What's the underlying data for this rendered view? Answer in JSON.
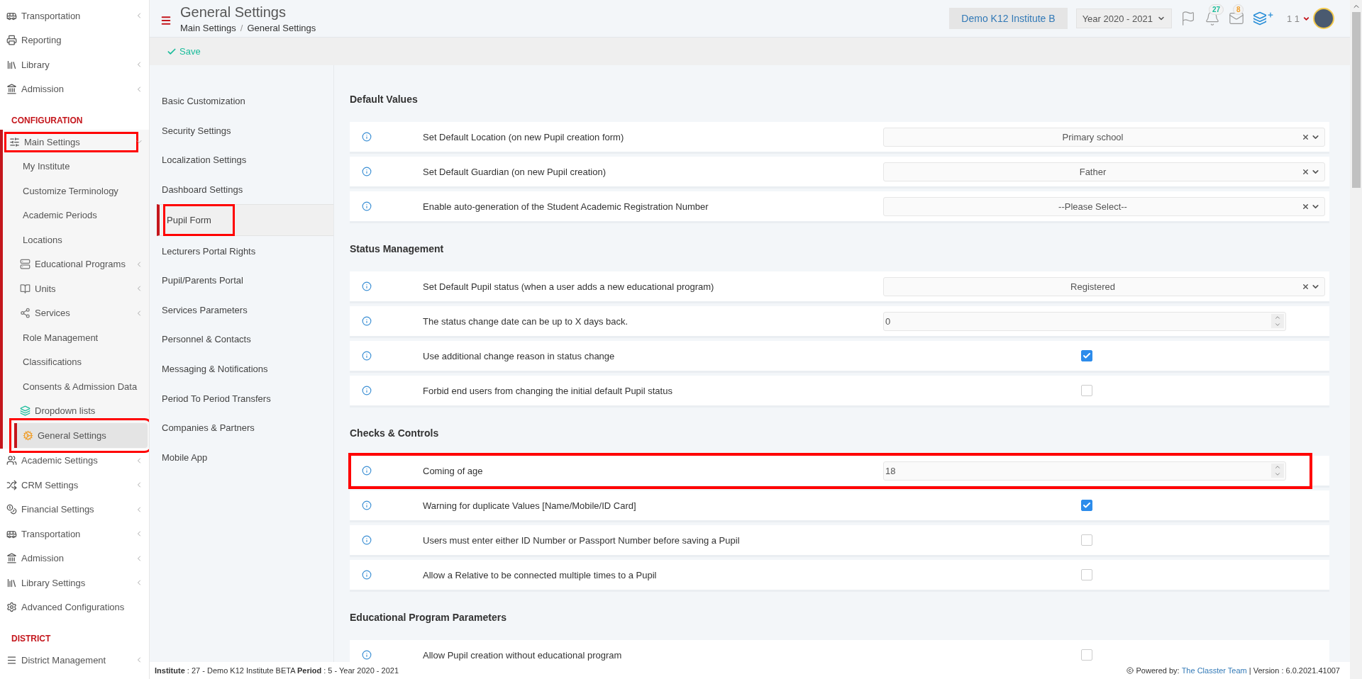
{
  "header": {
    "title": "General Settings",
    "breadcrumbs": [
      "Main Settings",
      "General Settings"
    ],
    "breadcrumb_separator": "/",
    "institute": "Demo K12 Institute B",
    "year": "Year 2020 - 2021",
    "notifications": "27",
    "messages": "8",
    "user": "1 1"
  },
  "toolbar": {
    "save": "Save"
  },
  "sidebar": {
    "sections": [
      {
        "items": [
          {
            "label": "Transportation",
            "has_submenu": true,
            "expanded": false,
            "selected": false,
            "highlighted": false
          },
          {
            "label": "Reporting",
            "has_submenu": false,
            "selected": false,
            "highlighted": false
          },
          {
            "label": "Library",
            "has_submenu": true,
            "expanded": false,
            "selected": false,
            "highlighted": false
          },
          {
            "label": "Admission",
            "has_submenu": true,
            "expanded": false,
            "selected": false,
            "highlighted": false
          }
        ]
      },
      {
        "title": "CONFIGURATION",
        "items": [
          {
            "label": "Main Settings",
            "has_submenu": true,
            "expanded": true,
            "selected": false,
            "highlighted": true,
            "children": [
              {
                "label": "My Institute",
                "has_submenu": false,
                "selected": false,
                "highlighted": false
              },
              {
                "label": "Customize Terminology",
                "has_submenu": false,
                "selected": false,
                "highlighted": false
              },
              {
                "label": "Academic Periods",
                "has_submenu": false,
                "selected": false,
                "highlighted": false
              },
              {
                "label": "Locations",
                "has_submenu": false,
                "selected": false,
                "highlighted": false
              },
              {
                "label": "Educational Programs",
                "has_submenu": true,
                "selected": false,
                "highlighted": false
              },
              {
                "label": "Units",
                "has_submenu": true,
                "selected": false,
                "highlighted": false
              },
              {
                "label": "Services",
                "has_submenu": true,
                "selected": false,
                "highlighted": false
              },
              {
                "label": "Role Management",
                "has_submenu": false,
                "selected": false,
                "highlighted": false
              },
              {
                "label": "Classifications",
                "has_submenu": false,
                "selected": false,
                "highlighted": false
              },
              {
                "label": "Consents & Admission Data",
                "has_submenu": false,
                "selected": false,
                "highlighted": false
              },
              {
                "label": "Dropdown lists",
                "has_submenu": false,
                "selected": false,
                "highlighted": false
              },
              {
                "label": "General Settings",
                "has_submenu": false,
                "selected": true,
                "highlighted": true
              }
            ]
          },
          {
            "label": "Academic Settings",
            "has_submenu": true,
            "expanded": false,
            "selected": false,
            "highlighted": false
          },
          {
            "label": "CRM Settings",
            "has_submenu": true,
            "expanded": false,
            "selected": false,
            "highlighted": false
          },
          {
            "label": "Financial Settings",
            "has_submenu": true,
            "expanded": false,
            "selected": false,
            "highlighted": false
          },
          {
            "label": "Transportation",
            "has_submenu": true,
            "expanded": false,
            "selected": false,
            "highlighted": false
          },
          {
            "label": "Admission",
            "has_submenu": true,
            "expanded": false,
            "selected": false,
            "highlighted": false
          },
          {
            "label": "Library Settings",
            "has_submenu": true,
            "expanded": false,
            "selected": false,
            "highlighted": false
          },
          {
            "label": "Advanced Configurations",
            "has_submenu": false,
            "selected": false,
            "highlighted": false
          }
        ]
      },
      {
        "title": "DISTRICT",
        "items": [
          {
            "label": "District Management",
            "has_submenu": true,
            "expanded": false,
            "selected": false,
            "highlighted": false
          }
        ]
      }
    ]
  },
  "submenu": [
    {
      "label": "Basic Customization",
      "selected": false,
      "highlighted": false
    },
    {
      "label": "Security Settings",
      "selected": false,
      "highlighted": false
    },
    {
      "label": "Localization Settings",
      "selected": false,
      "highlighted": false
    },
    {
      "label": "Dashboard Settings",
      "selected": false,
      "highlighted": false
    },
    {
      "label": "Pupil Form",
      "selected": true,
      "highlighted": true
    },
    {
      "label": "Lecturers Portal Rights",
      "selected": false,
      "highlighted": false
    },
    {
      "label": "Pupil/Parents Portal",
      "selected": false,
      "highlighted": false
    },
    {
      "label": "Services Parameters",
      "selected": false,
      "highlighted": false
    },
    {
      "label": "Personnel & Contacts",
      "selected": false,
      "highlighted": false
    },
    {
      "label": "Messaging & Notifications",
      "selected": false,
      "highlighted": false
    },
    {
      "label": "Period To Period Transfers",
      "selected": false,
      "highlighted": false
    },
    {
      "label": "Companies & Partners",
      "selected": false,
      "highlighted": false
    },
    {
      "label": "Mobile App",
      "selected": false,
      "highlighted": false
    }
  ],
  "settings": [
    {
      "title": "Default Values",
      "rows": [
        {
          "kind": "select",
          "label": "Set Default Location (on new Pupil creation form)",
          "value": "Primary school",
          "highlighted": false
        },
        {
          "kind": "select",
          "label": "Set Default Guardian (on new Pupil creation)",
          "value": "Father",
          "highlighted": false
        },
        {
          "kind": "select",
          "label": "Enable auto-generation of the Student Academic Registration Number",
          "value": "--Please Select--",
          "highlighted": false
        }
      ]
    },
    {
      "title": "Status Management",
      "rows": [
        {
          "kind": "select",
          "label": "Set Default Pupil status (when a user adds a new educational program)",
          "value": "Registered",
          "highlighted": false
        },
        {
          "kind": "number",
          "label": "The status change date can be up to X days back.",
          "value": "0",
          "highlighted": false
        },
        {
          "kind": "checkbox",
          "label": "Use additional change reason in status change",
          "checked": true,
          "highlighted": false
        },
        {
          "kind": "checkbox",
          "label": "Forbid end users from changing the initial default Pupil status",
          "checked": false,
          "highlighted": false
        }
      ]
    },
    {
      "title": "Checks & Controls",
      "rows": [
        {
          "kind": "number",
          "label": "Coming of age",
          "value": "18",
          "highlighted": true
        },
        {
          "kind": "checkbox",
          "label": "Warning for duplicate Values [Name/Mobile/ID Card]",
          "checked": true,
          "highlighted": false
        },
        {
          "kind": "checkbox",
          "label": "Users must enter either ID Number or Passport Number before saving a Pupil",
          "checked": false,
          "highlighted": false
        },
        {
          "kind": "checkbox",
          "label": "Allow a Relative to be connected multiple times to a Pupil",
          "checked": false,
          "highlighted": false
        }
      ]
    },
    {
      "title": "Educational Program Parameters",
      "rows": [
        {
          "kind": "checkbox",
          "label": "Allow Pupil creation without educational program",
          "checked": false,
          "highlighted": false
        }
      ]
    }
  ],
  "footer": {
    "info": "**Institute** : 27 - Demo K12 Institute BETA **Period** : 5 - Year 2020 - 2021",
    "powered_by": "Powered by:",
    "team": "The Classter Team",
    "version": "| Version : 6.0.2021.41007"
  }
}
